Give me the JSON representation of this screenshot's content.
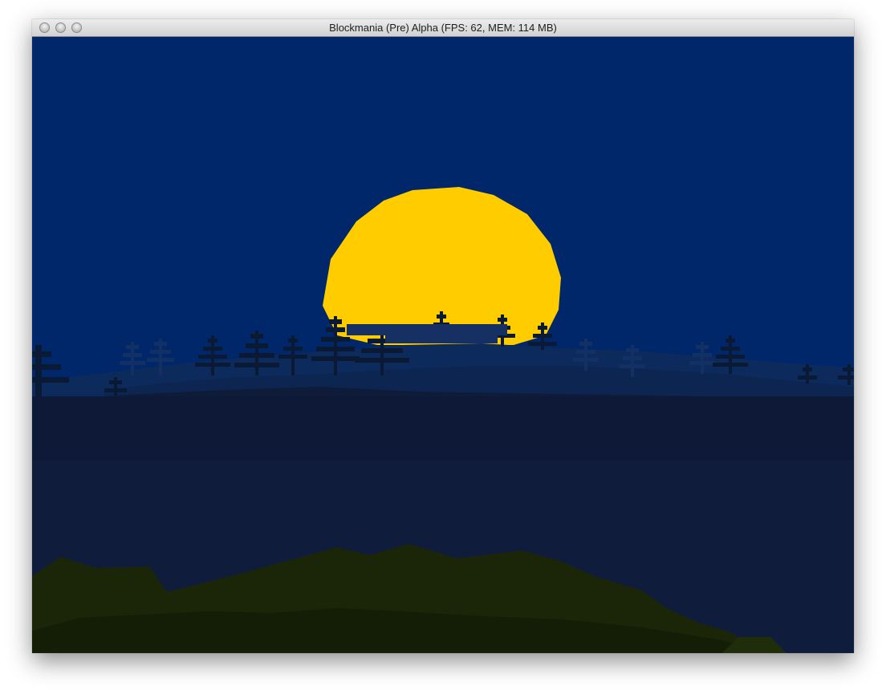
{
  "window": {
    "title": "Blockmania (Pre) Alpha (FPS: 62, MEM: 114 MB)"
  },
  "scene": {
    "sky_color": "#00276a",
    "sun_color": "#ffcc00",
    "water_color": "#101c3c",
    "grass_color": "#1b2608",
    "tree_color": "#0a1a35"
  }
}
